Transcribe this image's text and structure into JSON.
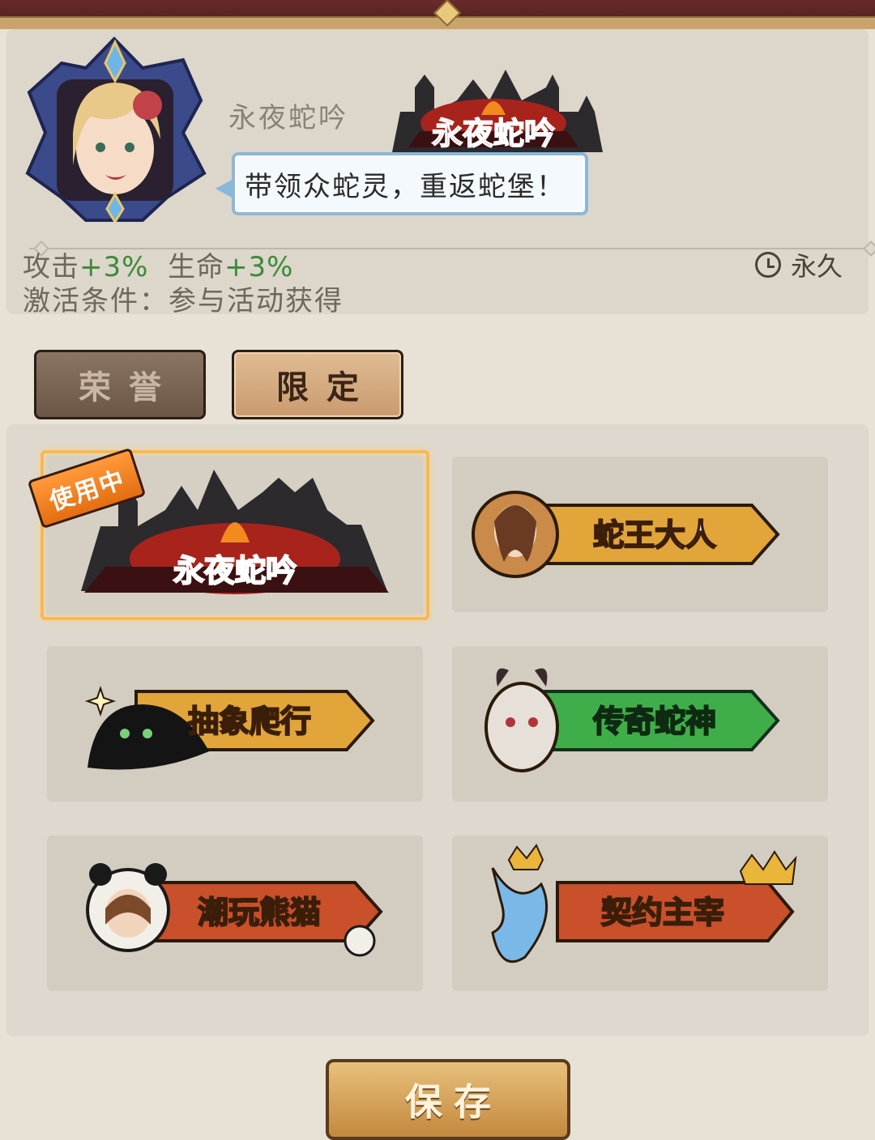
{
  "title_detail": {
    "name": "永夜蛇吟",
    "badge_text": "永夜蛇吟",
    "motto": "带领众蛇灵，重返蛇堡！",
    "stats_prefix_attack": "攻击",
    "stats_attack_value": "+3%",
    "stats_prefix_hp": "生命",
    "stats_hp_value": "+3%",
    "condition": "激活条件：参与活动获得",
    "duration": "永久",
    "duration_icon": "clock-icon"
  },
  "tabs": [
    {
      "label": "荣誉",
      "active": false
    },
    {
      "label": "限定",
      "active": true
    }
  ],
  "titles": [
    {
      "label": "永夜蛇吟",
      "style": "castle",
      "in_use": true,
      "in_use_label": "使用中"
    },
    {
      "label": "蛇王大人",
      "style": "gold"
    },
    {
      "label": "抽象爬行",
      "style": "gold"
    },
    {
      "label": "传奇蛇神",
      "style": "green"
    },
    {
      "label": "潮玩熊猫",
      "style": "red"
    },
    {
      "label": "契约主宰",
      "style": "red"
    }
  ],
  "save_label": "保存",
  "colors": {
    "stat_green": "#3d8a3a",
    "selection_border": "#f6b955",
    "gold_banner": "#e2a53a",
    "green_banner": "#3fae4a",
    "red_banner": "#c9502a"
  }
}
